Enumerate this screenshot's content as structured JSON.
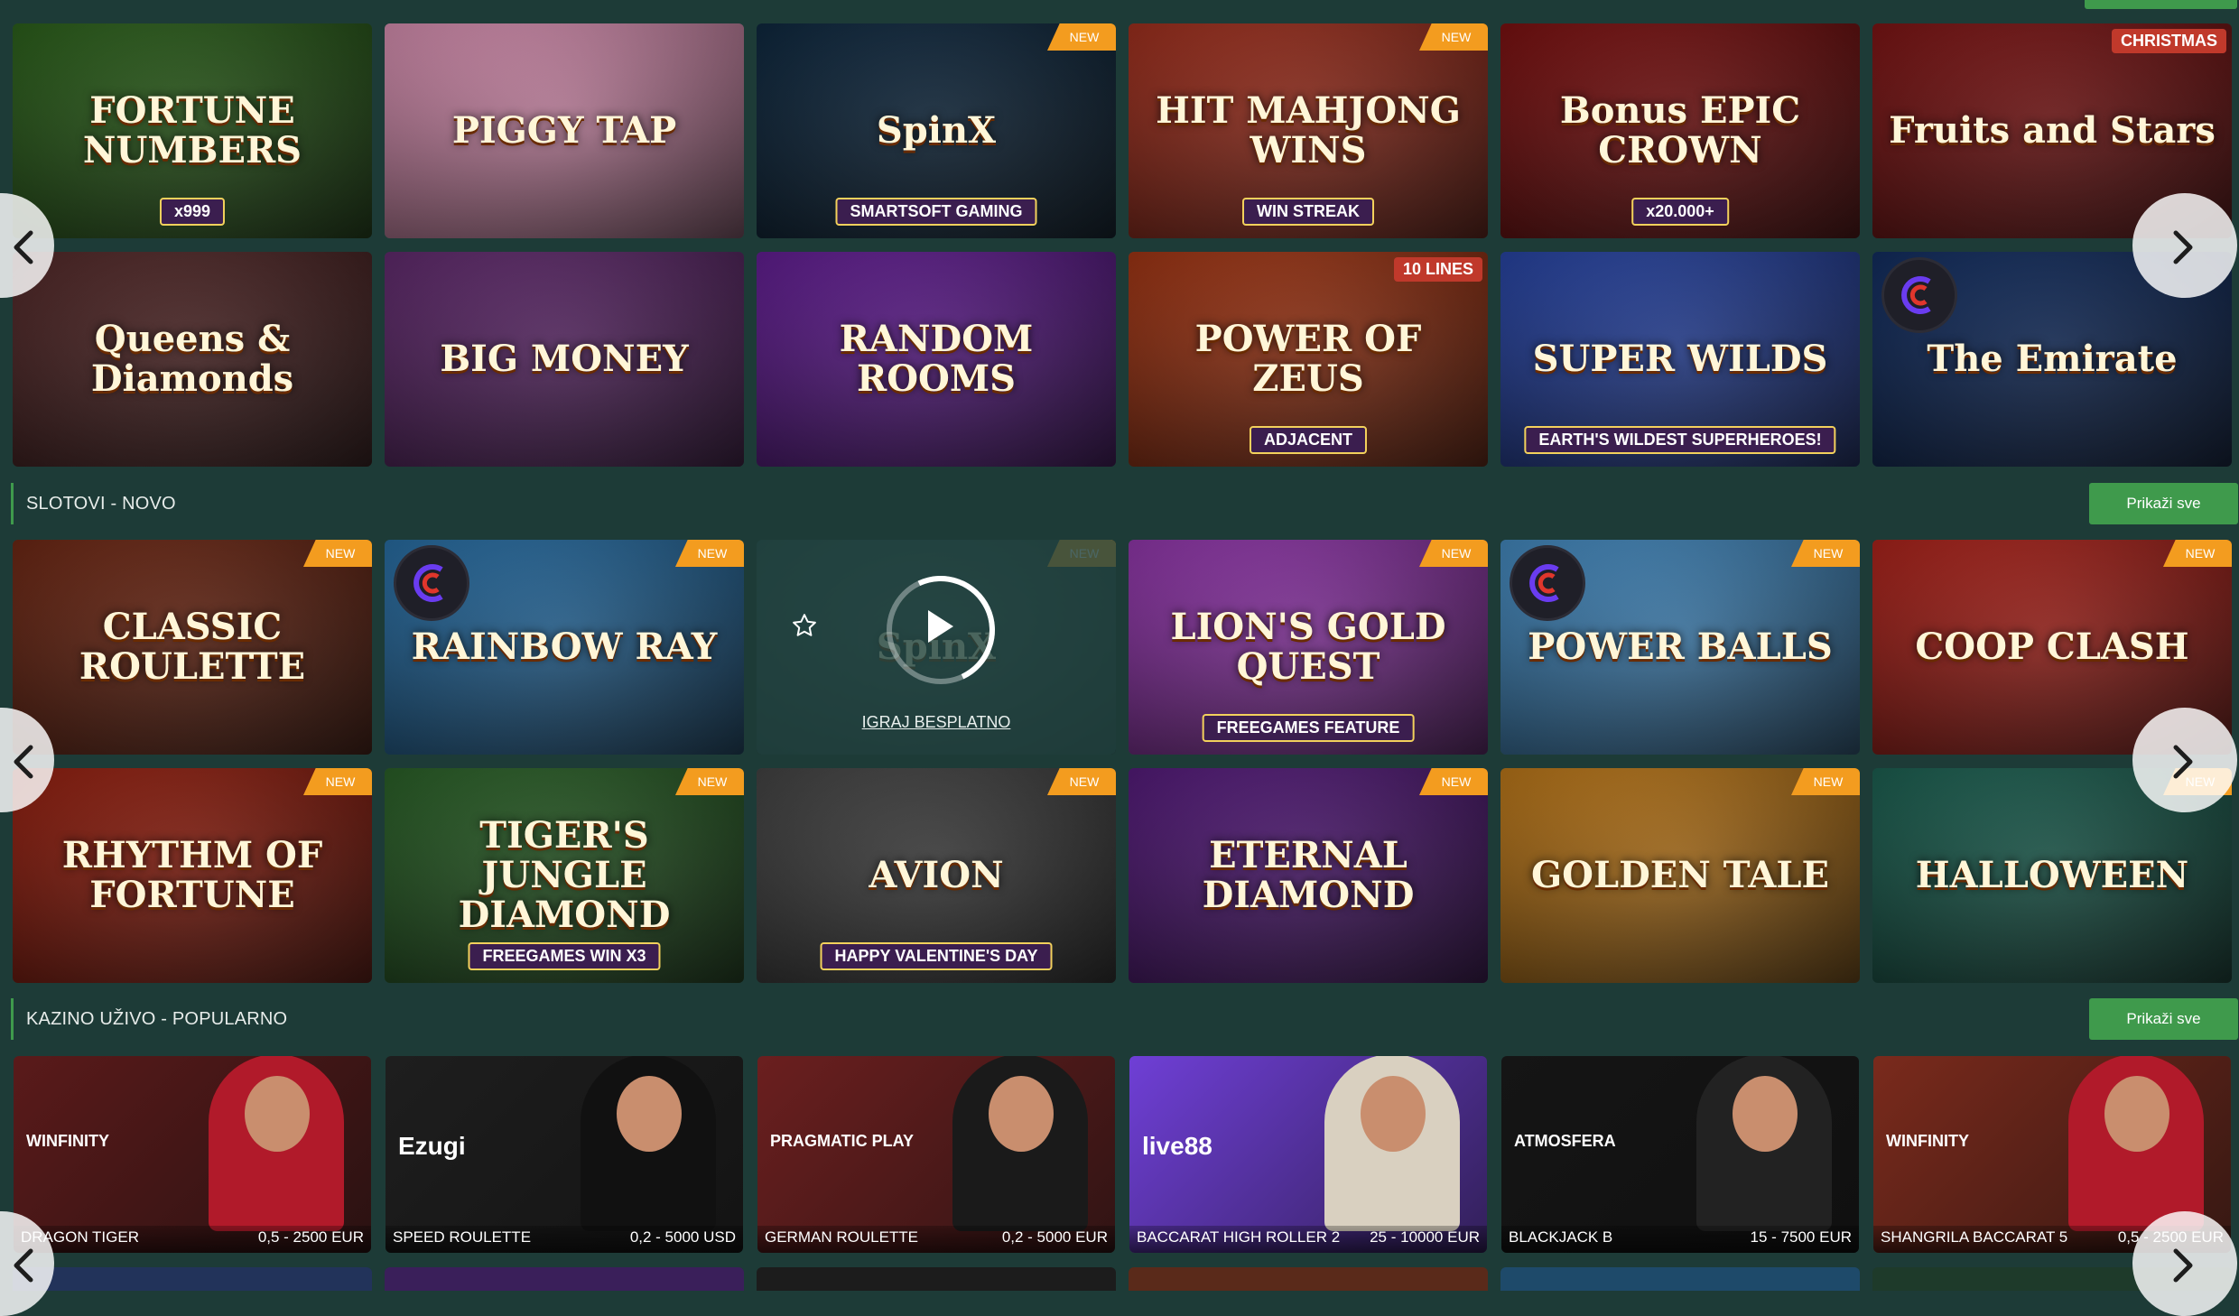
{
  "colors": {
    "background": "#1d3b37",
    "accent_green": "#3f9a4c",
    "new_badge": "#f39c1f"
  },
  "top_carousel": {
    "rows": [
      [
        {
          "title": "FORTUNE NUMBERS",
          "sub": "x999",
          "badge": "",
          "color": "#2f6b1c"
        },
        {
          "title": "PIGGY TAP",
          "sub": "",
          "badge": "",
          "color": "#f2a0c6"
        },
        {
          "title": "SpinX",
          "sub": "SMARTSOFT GAMING",
          "badge": "NEW",
          "color": "#0d2a44"
        },
        {
          "title": "HIT MAHJONG WINS",
          "sub": "WIN STREAK",
          "badge": "NEW",
          "color": "#b3331f"
        },
        {
          "title": "Bonus EPIC CROWN",
          "sub": "x20.000+",
          "badge": "",
          "color": "#8a1010"
        },
        {
          "title": "Fruits and Stars",
          "sub": "",
          "badge": "CHRISTMAS",
          "color": "#8c1414"
        }
      ],
      [
        {
          "title": "Queens & Diamonds",
          "sub": "",
          "badge": "",
          "color": "#5a2a2a"
        },
        {
          "title": "BIG MONEY",
          "sub": "",
          "badge": "",
          "color": "#6b2d7a"
        },
        {
          "title": "RANDOM ROOMS",
          "sub": "",
          "badge": "",
          "color": "#6d1fa5"
        },
        {
          "title": "POWER OF ZEUS",
          "sub": "ADJACENT",
          "badge": "10 LINES",
          "color": "#b53a14"
        },
        {
          "title": "SUPER WILDS",
          "sub": "EARTH'S WILDEST SUPERHEROES!",
          "badge": "",
          "color": "#2a4bb8"
        },
        {
          "title": "The Emirate",
          "sub": "",
          "badge": "",
          "color": "#11306a"
        }
      ]
    ]
  },
  "sections": {
    "new_slots": {
      "title": "SLOTOVI - NOVO",
      "show_all": "Prikaži sve",
      "hover": {
        "play_free": "IGRAJ BESPLATNO"
      },
      "rows": [
        [
          {
            "title": "CLASSIC ROULETTE",
            "sub": "",
            "badge": "NEW",
            "color": "#7a2a14"
          },
          {
            "title": "RAINBOW RAY",
            "sub": "",
            "badge": "NEW",
            "color": "#2a7ab8"
          },
          {
            "title": "SpinX",
            "sub": "",
            "badge": "NEW",
            "color": "#244442"
          },
          {
            "title": "LION'S GOLD QUEST",
            "sub": "FREEGAMES FEATURE",
            "badge": "NEW",
            "color": "#a43cc2"
          },
          {
            "title": "POWER BALLS",
            "sub": "",
            "badge": "NEW",
            "color": "#4a9ad8"
          },
          {
            "title": "COOP CLASH",
            "sub": "",
            "badge": "NEW",
            "color": "#c2251c"
          }
        ],
        [
          {
            "title": "RHYTHM OF FORTUNE",
            "sub": "",
            "badge": "NEW",
            "color": "#a6210f"
          },
          {
            "title": "TIGER'S JUNGLE DIAMOND",
            "sub": "FREEGAMES WIN X3",
            "badge": "NEW",
            "color": "#2d6b2a"
          },
          {
            "title": "AVION",
            "sub": "HAPPY VALENTINE'S DAY",
            "badge": "NEW",
            "color": "#4a4a4a"
          },
          {
            "title": "ETERNAL DIAMOND",
            "sub": "",
            "badge": "NEW",
            "color": "#5e1c8a"
          },
          {
            "title": "GOLDEN TALE",
            "sub": "",
            "badge": "NEW",
            "color": "#d4861a"
          },
          {
            "title": "HALLOWEEN",
            "sub": "",
            "badge": "NEW",
            "color": "#1d6b5a"
          }
        ]
      ]
    },
    "live_casino": {
      "title": "KAZINO UŽIVO - POPULARNO",
      "show_all": "Prikaži sve",
      "tiles": [
        {
          "name": "DRAGON TIGER",
          "limit": "0,5 - 2500 EUR",
          "provider": "WINFINITY",
          "color": "#5a1a1a",
          "dress": "#b11a2a"
        },
        {
          "name": "SPEED ROULETTE",
          "limit": "0,2 - 5000 USD",
          "provider": "Ezugi",
          "color": "#1e1e1e",
          "dress": "#111111"
        },
        {
          "name": "GERMAN ROULETTE",
          "limit": "0,2 - 5000 EUR",
          "provider": "PRAGMATIC PLAY",
          "color": "#6b1f1f",
          "dress": "#1a1a1a"
        },
        {
          "name": "BACCARAT HIGH ROLLER 2",
          "limit": "25 - 10000 EUR",
          "provider": "live88",
          "color": "#6f3fd6",
          "dress": "#d9d0c0"
        },
        {
          "name": "BLACKJACK B",
          "limit": "15 - 7500 EUR",
          "provider": "ATMOSFERA",
          "color": "#151515",
          "dress": "#222222"
        },
        {
          "name": "SHANGRILA BACCARAT 5",
          "limit": "0,5 - 2500 EUR",
          "provider": "WINFINITY",
          "color": "#7a2a1c",
          "dress": "#b11a2a"
        }
      ]
    }
  }
}
